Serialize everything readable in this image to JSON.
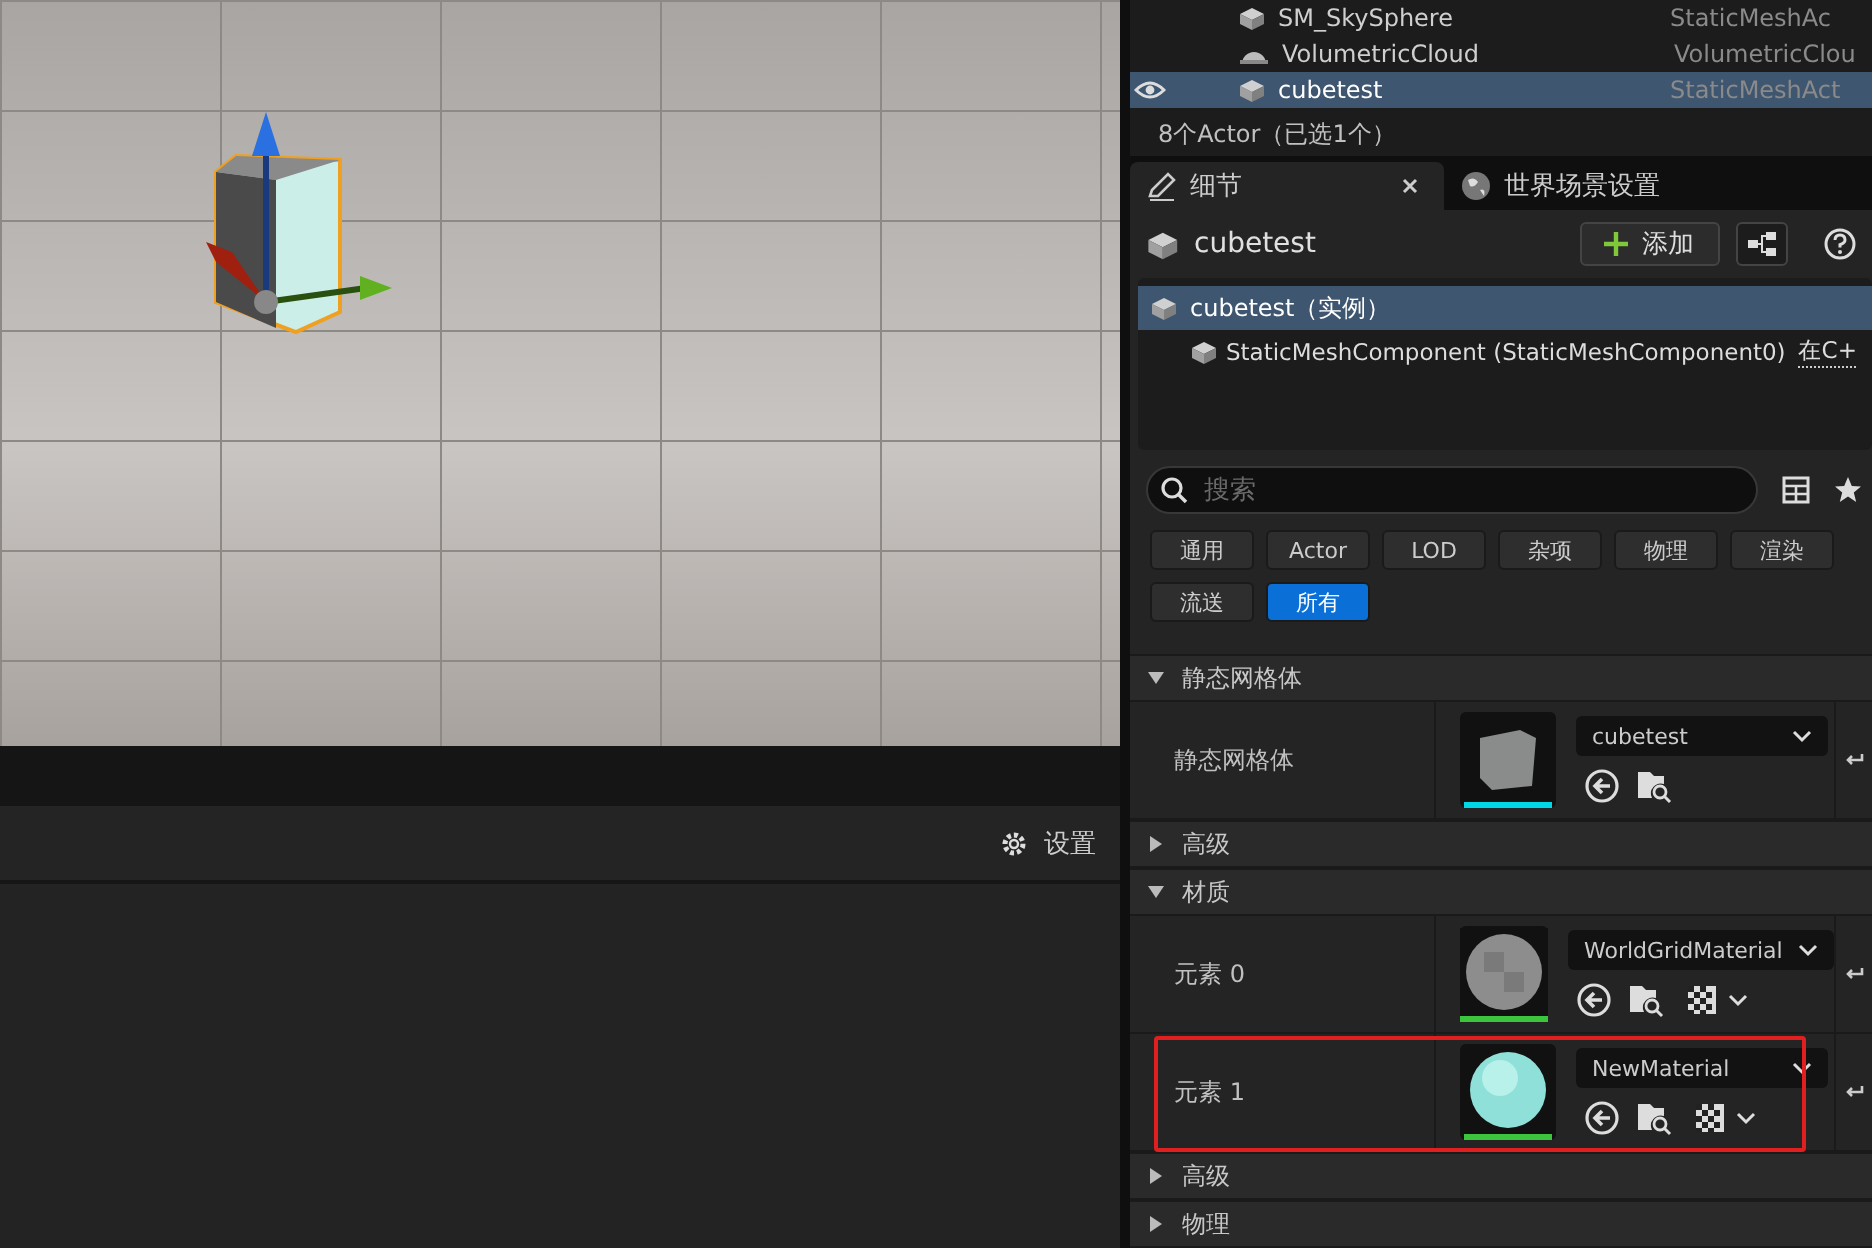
{
  "viewport": {
    "settings_label": "设置"
  },
  "outliner": {
    "rows": [
      {
        "name": "SM_SkySphere",
        "type": "StaticMeshAc",
        "kind": "mesh",
        "selected": false,
        "visible": false
      },
      {
        "name": "VolumetricCloud",
        "type": "VolumetricClou",
        "kind": "cloud",
        "selected": false,
        "visible": false
      },
      {
        "name": "cubetest",
        "type": "StaticMeshAct",
        "kind": "mesh",
        "selected": true,
        "visible": true
      }
    ],
    "status": "8个Actor（已选1个）"
  },
  "details": {
    "tabs": [
      {
        "label": "细节",
        "kind": "details",
        "selected": true,
        "closable": true
      },
      {
        "label": "世界场景设置",
        "kind": "world",
        "selected": false,
        "closable": false
      }
    ],
    "actor_name": "cubetest",
    "add_button": "添加",
    "components": [
      {
        "label": "cubetest（实例）",
        "selected": true,
        "children": [
          {
            "label": "StaticMeshComponent (StaticMeshComponent0)",
            "link": "在C+",
            "selected": false
          }
        ]
      }
    ],
    "search": {
      "placeholder": "搜索"
    },
    "filters": [
      {
        "label": "通用",
        "selected": false
      },
      {
        "label": "Actor",
        "selected": false
      },
      {
        "label": "LOD",
        "selected": false
      },
      {
        "label": "杂项",
        "selected": false
      },
      {
        "label": "物理",
        "selected": false
      },
      {
        "label": "渲染",
        "selected": false
      },
      {
        "label": "流送",
        "selected": false
      },
      {
        "label": "所有",
        "selected": true
      }
    ],
    "sections": [
      {
        "title": "静态网格体",
        "expanded": true,
        "rows": [
          {
            "label": "静态网格体",
            "asset": "cubetest",
            "kind": "mesh",
            "color": "#00d8e8",
            "highlighted": false
          }
        ]
      },
      {
        "title": "高级",
        "expanded": false
      },
      {
        "title": "材质",
        "expanded": true,
        "rows": [
          {
            "label": "元素 0",
            "asset": "WorldGridMaterial",
            "kind": "grid-material",
            "color": "#3cc43c",
            "highlighted": false
          },
          {
            "label": "元素 1",
            "asset": "NewMaterial",
            "kind": "teal-material",
            "color": "#3cc43c",
            "highlighted": true
          }
        ]
      },
      {
        "title": "高级",
        "expanded": false
      },
      {
        "title": "物理",
        "expanded": false
      }
    ]
  }
}
